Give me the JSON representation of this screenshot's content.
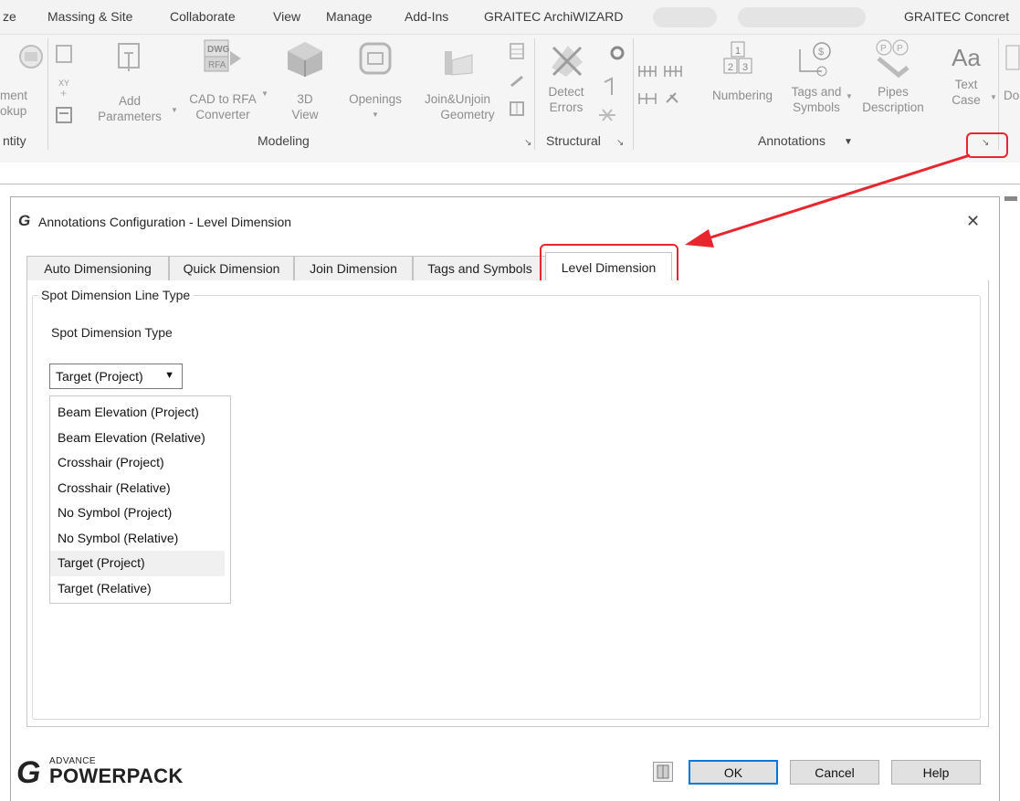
{
  "ribbon": {
    "tabs": [
      {
        "label": "ze"
      },
      {
        "label": "Massing & Site"
      },
      {
        "label": "Collaborate"
      },
      {
        "label": "View"
      },
      {
        "label": "Manage"
      },
      {
        "label": "Add-Ins"
      },
      {
        "label": "GRAITEC ArchiWIZARD"
      },
      {
        "label": "GRAITEC Concret"
      }
    ],
    "buttons": {
      "entity_mockup": {
        "line1": "ment",
        "line2": "okup"
      },
      "add_parameters": {
        "line1": "Add",
        "line2": "Parameters"
      },
      "cad_to_rfa": {
        "line1": "CAD to RFA",
        "line2": "Converter",
        "icon_text1": "DWG",
        "icon_text2": "RFA"
      },
      "view_3d": {
        "line1": "3D",
        "line2": "View"
      },
      "openings": {
        "line1": "Openings"
      },
      "join_unjoin": {
        "line1": "Join&Unjoin",
        "line2": "Geometry"
      },
      "detect_errors": {
        "line1": "Detect",
        "line2": "Errors"
      },
      "numbering": {
        "label": "Numbering",
        "icon_text": [
          "1",
          "2",
          "3"
        ]
      },
      "tags_symbols": {
        "line1": "Tags and",
        "line2": "Symbols"
      },
      "pipes_description": {
        "line1": "Pipes",
        "line2": "Description"
      },
      "text_case": {
        "line1": "Text",
        "line2": "Case",
        "icon_text": "Aa"
      },
      "cut_off": {
        "line1": "Do"
      }
    },
    "panels": {
      "entity": "ntity",
      "modeling": "Modeling",
      "structural": "Structural",
      "annotations": "Annotations"
    },
    "icons": [
      "launcher-icon",
      "dropdown-icon"
    ]
  },
  "dialog": {
    "title": "Annotations Configuration - Level Dimension",
    "tabs": [
      {
        "label": "Auto Dimensioning"
      },
      {
        "label": "Quick Dimension"
      },
      {
        "label": "Join Dimension"
      },
      {
        "label": "Tags and Symbols"
      },
      {
        "label": "Level Dimension"
      }
    ],
    "active_tab": "Level Dimension",
    "group_title": "Spot Dimension Line Type",
    "field_label": "Spot Dimension Type",
    "combo_value": "Target (Project)",
    "options": [
      {
        "label": "Beam Elevation (Project)"
      },
      {
        "label": "Beam Elevation (Relative)"
      },
      {
        "label": "Crosshair (Project)"
      },
      {
        "label": "Crosshair (Relative)"
      },
      {
        "label": "No Symbol (Project)"
      },
      {
        "label": "No Symbol (Relative)"
      },
      {
        "label": "Target (Project)"
      },
      {
        "label": "Target (Relative)"
      }
    ],
    "buttons": {
      "ok": "OK",
      "cancel": "Cancel",
      "help": "Help"
    },
    "logo": {
      "top": "ADVANCE",
      "bottom": "POWERPACK",
      "mark": "G"
    }
  },
  "colors": {
    "highlight": "#e8262d",
    "focus_border": "#0078d7"
  }
}
